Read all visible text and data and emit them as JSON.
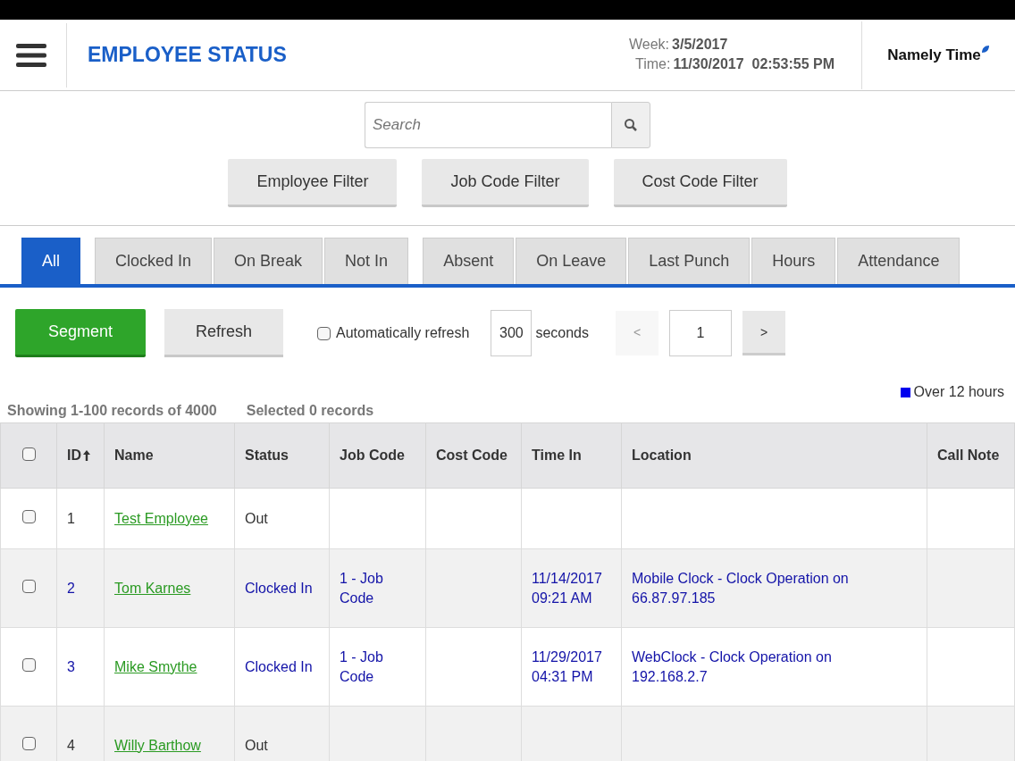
{
  "header": {
    "title": "EMPLOYEE STATUS",
    "week_label": "Week:",
    "week": "3/5/2017",
    "time_label": "Time:",
    "time": "11/30/2017  02:53:55 PM",
    "brand": "Namely Time"
  },
  "search": {
    "placeholder": "Search"
  },
  "filters": [
    "Employee Filter",
    "Job Code Filter",
    "Cost Code Filter"
  ],
  "tabs": [
    {
      "label": "All",
      "selected": true
    },
    {
      "label": "Clocked In",
      "selected": false
    },
    {
      "label": "On Break",
      "selected": false
    },
    {
      "label": "Not In",
      "selected": false
    },
    {
      "label": "Absent",
      "selected": false
    },
    {
      "label": "On Leave",
      "selected": false
    },
    {
      "label": "Last Punch",
      "selected": false
    },
    {
      "label": "Hours",
      "selected": false
    },
    {
      "label": "Attendance",
      "selected": false
    }
  ],
  "toolbar": {
    "segment": "Segment",
    "refresh": "Refresh",
    "auto_refresh": {
      "label": "Automatically refresh",
      "checked": false
    },
    "interval": "300",
    "interval_unit": "seconds",
    "prev": {
      "label": "<",
      "disabled": true
    },
    "page": "1",
    "next": {
      "label": ">",
      "disabled": false
    }
  },
  "legend": {
    "label": "Over 12 hours",
    "color": "#0000ee"
  },
  "summary": {
    "showing": "Showing 1-100 records of 4000",
    "selected": "Selected 0 records"
  },
  "table": {
    "select_all": false,
    "columns": [
      "ID",
      "Name",
      "Status",
      "Job Code",
      "Cost Code",
      "Time In",
      "Location",
      "Call Note"
    ],
    "rows": [
      {
        "checked": false,
        "kind": "out",
        "id": "1",
        "name": "Test Employee",
        "status": "Out",
        "job_code": "",
        "time_in": "",
        "location": ""
      },
      {
        "checked": false,
        "kind": "in",
        "id": "2",
        "name": "Tom Karnes",
        "status": "Clocked In",
        "job_code": "1 - Job Code",
        "time_in": "11/14/2017 09:21 AM",
        "location": "Mobile Clock - Clock Operation on 66.87.97.185"
      },
      {
        "checked": false,
        "kind": "in",
        "id": "3",
        "name": "Mike Smythe",
        "status": "Clocked In",
        "job_code": "1 - Job Code",
        "time_in": "11/29/2017 04:31 PM",
        "location": "WebClock - Clock Operation on 192.168.2.7"
      },
      {
        "checked": false,
        "kind": "out",
        "id": "4",
        "name": "Willy Barthow",
        "status": "Out",
        "job_code": "",
        "time_in": "",
        "location": ""
      }
    ]
  }
}
